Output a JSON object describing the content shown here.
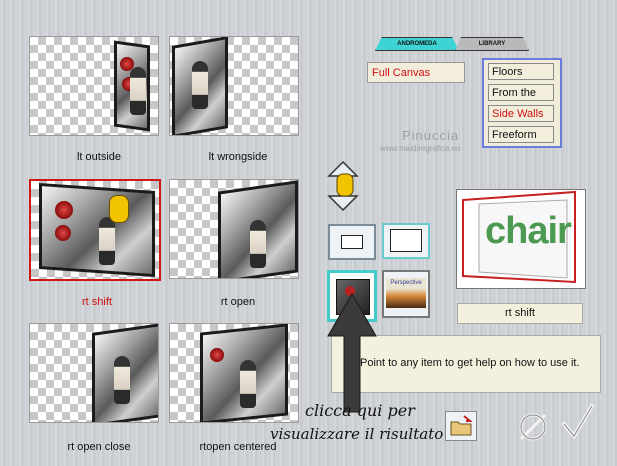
{
  "tabs": {
    "andromeda": "ANDROMEDA",
    "library": "LIBRARY"
  },
  "canvas_mode": "Full Canvas",
  "list": {
    "items": [
      "Floors",
      "From the Top",
      "Side Walls",
      "Freeform"
    ],
    "selected": "Side Walls"
  },
  "watermark": {
    "name": "Pinuccia",
    "url": "www.maidiregrafica.eu"
  },
  "thumbnails": [
    {
      "label": "lt outside"
    },
    {
      "label": "lt wrongside"
    },
    {
      "label": "rt shift",
      "selected": true
    },
    {
      "label": "rt open"
    },
    {
      "label": "rt open close"
    },
    {
      "label": "rtopen centered"
    }
  ],
  "preview": {
    "word": "chair"
  },
  "selection_label": "rt shift",
  "preset_thumb_label": "Perspective",
  "help_text": "Point to any item to get help on how to use it.",
  "annotation": {
    "line1": "clicca qui per",
    "line2": "visualizzare il risultato"
  },
  "colors": {
    "selected_text": "#cc1010",
    "list_border": "#6a7be0",
    "button_border": "#66cccc",
    "panel_bg": "#f4f0de"
  },
  "icons": [
    "arrows-hand-icon",
    "folder-open-icon",
    "cancel-icon",
    "ok-check-icon"
  ]
}
